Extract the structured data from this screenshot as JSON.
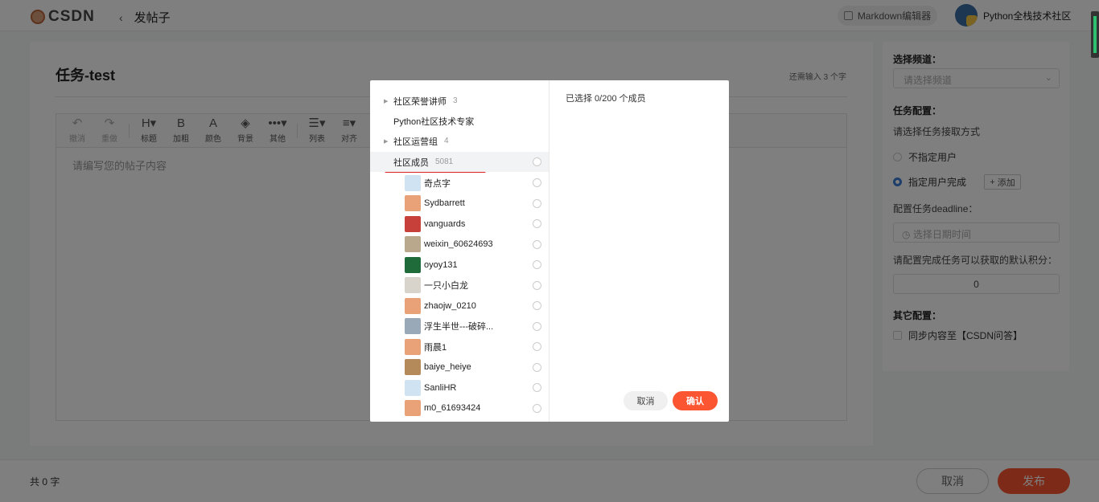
{
  "header": {
    "logo_text": "CSDN",
    "back_title": "发帖子",
    "markdown_button": "Markdown编辑器",
    "community_name": "Python全栈技术社区"
  },
  "editor": {
    "post_title": "任务-test",
    "remaining": "还需输入 3 个字",
    "placeholder": "请编写您的帖子内容",
    "tools": [
      {
        "glyph": "↶",
        "label": "撤消",
        "icon": "undo-icon"
      },
      {
        "glyph": "↷",
        "label": "重做",
        "icon": "redo-icon"
      },
      {
        "glyph": "H▾",
        "label": "标题",
        "icon": "heading-icon"
      },
      {
        "glyph": "B",
        "label": "加粗",
        "icon": "bold-icon"
      },
      {
        "glyph": "A",
        "label": "颜色",
        "icon": "font-color-icon"
      },
      {
        "glyph": "◈",
        "label": "背景",
        "icon": "background-icon"
      },
      {
        "glyph": "•••▾",
        "label": "其他",
        "icon": "more-icon"
      },
      {
        "glyph": "☰▾",
        "label": "列表",
        "icon": "list-icon"
      },
      {
        "glyph": "≡▾",
        "label": "对齐",
        "icon": "align-icon"
      }
    ]
  },
  "side": {
    "channel_heading": "选择频道：",
    "channel_placeholder": "请选择频道",
    "task_heading": "任务配置：",
    "task_mode_prompt": "请选择任务接取方式",
    "option_no_user": "不指定用户",
    "option_assign_user": "指定用户完成",
    "add_button": "添加",
    "deadline_label": "配置任务deadline：",
    "deadline_placeholder": "选择日期时间",
    "points_label": "请配置完成任务可以获取的默认积分：",
    "points_value": "0",
    "other_heading": "其它配置：",
    "sync_option": "同步内容至【CSDN问答】"
  },
  "footer": {
    "word_count": "共 0 字",
    "cancel": "取消",
    "publish": "发布"
  },
  "modal": {
    "groups": [
      {
        "name": "社区荣誉讲师",
        "count": "3",
        "expandable": true
      },
      {
        "name": "Python社区技术专家",
        "count": "",
        "expandable": false
      },
      {
        "name": "社区运营组",
        "count": "4",
        "expandable": true
      },
      {
        "name": "社区成员",
        "count": "5081",
        "expandable": true
      }
    ],
    "members": [
      {
        "name": "奇点字",
        "color": "#cfe3f3"
      },
      {
        "name": "Sydbarrett",
        "color": "#e9a178"
      },
      {
        "name": "vanguards",
        "color": "#c8403a"
      },
      {
        "name": "weixin_60624693",
        "color": "#b9a88c"
      },
      {
        "name": "oyoy131",
        "color": "#1f6b3a"
      },
      {
        "name": "一只小白龙",
        "color": "#d8d4cc"
      },
      {
        "name": "zhaojw_0210",
        "color": "#e9a178"
      },
      {
        "name": "浮生半世---破碎...",
        "color": "#9aa9b8"
      },
      {
        "name": "雨晨1",
        "color": "#e9a178"
      },
      {
        "name": "baiye_heiye",
        "color": "#b58a5a"
      },
      {
        "name": "SanliHR",
        "color": "#cfe3f3"
      },
      {
        "name": "m0_61693424",
        "color": "#e9a178"
      }
    ],
    "selected_count": "已选择 0/200 个成员",
    "cancel": "取消",
    "confirm": "确认"
  }
}
